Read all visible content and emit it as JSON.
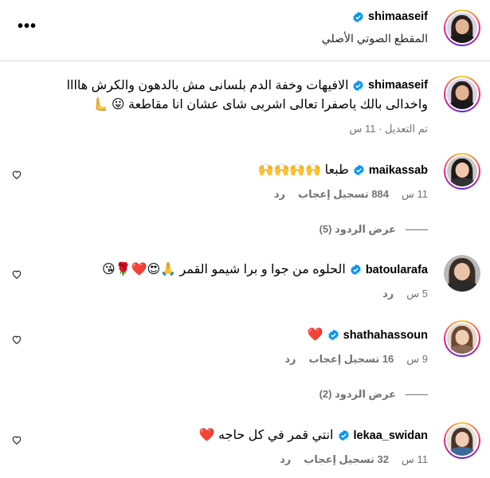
{
  "post": {
    "username": "shimaaseif",
    "audio_label": "المقطع الصوتي الأصلي",
    "more_icon": "more-horizontal-icon"
  },
  "caption": {
    "username": "shimaaseif",
    "text_line1": "الافيهات وخفة الدم بلسانى مش بالدهون والكرش هاااا",
    "text_line2": "واخدالى بالك ياصفرا تعالى اشربى شاى عشان انا مقاطعة 😛 🫷",
    "meta": "تم التعديل · 11 س"
  },
  "comments": [
    {
      "username": "maikassab",
      "text": "طبعا 🙌🙌🙌🙌",
      "time": "11 س",
      "likes": "884 تسجيل إعجاب",
      "reply": "رد",
      "view_replies": "عرض الردود (5)"
    },
    {
      "username": "batoularafa",
      "text": "الحلوه من جوا و برا شيمو القمر 🙏😍❤️🌹😘",
      "time": "5 س",
      "likes": "",
      "reply": "رد",
      "view_replies": ""
    },
    {
      "username": "shathahassoun",
      "text": "❤️",
      "time": "9 س",
      "likes": "16 تسجيل إعجاب",
      "reply": "رد",
      "view_replies": "عرض الردود (2)"
    },
    {
      "username": "lekaa_swidan",
      "text": "انتي قمر في كل حاجه ❤️",
      "time": "11 س",
      "likes": "32 تسجيل إعجاب",
      "reply": "رد",
      "view_replies": ""
    }
  ],
  "colors": {
    "verified": "#0095f6",
    "muted": "#737373",
    "divider": "#dbdbdb"
  }
}
